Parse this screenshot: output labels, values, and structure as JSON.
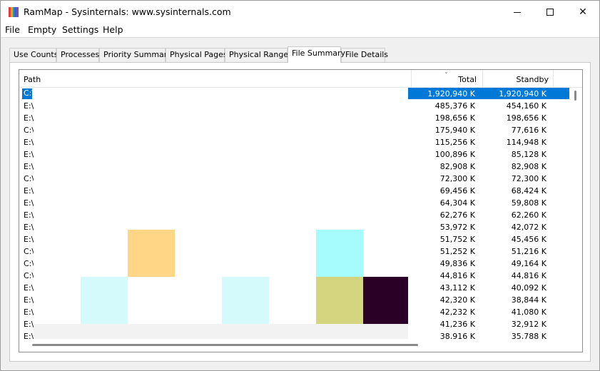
{
  "window": {
    "title": "RamMap - Sysinternals: www.sysinternals.com",
    "icon_colors": [
      "#e63946",
      "#f4a300",
      "#2a9d8f",
      "#3a5fcd",
      "#8e44ad"
    ]
  },
  "menu": {
    "items": [
      "File",
      "Empty",
      "Settings",
      "Help"
    ]
  },
  "tabs": [
    {
      "label": "Use Counts"
    },
    {
      "label": "Processes"
    },
    {
      "label": "Priority Summary"
    },
    {
      "label": "Physical Pages"
    },
    {
      "label": "Physical Ranges"
    },
    {
      "label": "File Summary",
      "active": true
    },
    {
      "label": "File Details"
    }
  ],
  "table": {
    "columns": {
      "path": "Path",
      "total": "Total",
      "standby": "Standby"
    },
    "sort_indicator": "⌄",
    "rows": [
      {
        "path": "C:\\",
        "total": "1,920,940 K",
        "standby": "1,920,940 K",
        "selected": true
      },
      {
        "path": "E:\\",
        "total": "485,376 K",
        "standby": "454,160 K"
      },
      {
        "path": "E:\\",
        "total": "198,656 K",
        "standby": "198,656 K"
      },
      {
        "path": "C:\\",
        "total": "175,940 K",
        "standby": "77,616 K"
      },
      {
        "path": "E:\\",
        "total": "115,256 K",
        "standby": "114,948 K"
      },
      {
        "path": "E:\\",
        "total": "100,896 K",
        "standby": "85,128 K"
      },
      {
        "path": "E:\\",
        "total": "82,908 K",
        "standby": "82,908 K"
      },
      {
        "path": "C:\\",
        "total": "72,300 K",
        "standby": "72,300 K"
      },
      {
        "path": "E:\\",
        "total": "69,456 K",
        "standby": "68,424 K"
      },
      {
        "path": "E:\\",
        "total": "64,304 K",
        "standby": "59,808 K"
      },
      {
        "path": "E:\\",
        "total": "62,276 K",
        "standby": "62,260 K"
      },
      {
        "path": "E:\\",
        "total": "53,972 K",
        "standby": "42,072 K"
      },
      {
        "path": "E:\\",
        "total": "51,752 K",
        "standby": "45,456 K"
      },
      {
        "path": "C:\\",
        "total": "51,252 K",
        "standby": "51,216 K"
      },
      {
        "path": "C:\\",
        "total": "49,836 K",
        "standby": "49,164 K"
      },
      {
        "path": "C:\\",
        "total": "44,816 K",
        "standby": "44,816 K"
      },
      {
        "path": "E:\\",
        "total": "43,112 K",
        "standby": "40,092 K"
      },
      {
        "path": "E:\\",
        "total": "42,320 K",
        "standby": "38,844 K"
      },
      {
        "path": "E:\\",
        "total": "42,232 K",
        "standby": "41,080 K"
      },
      {
        "path": "E:\\",
        "total": "41,236 K",
        "standby": "32,912 K"
      },
      {
        "path": "E:\\",
        "total": "38,916 K",
        "standby": "35,788 K"
      }
    ]
  },
  "redaction_colors": [
    "#ffd685",
    "#a6fbfd",
    "#d5fafc",
    "#d5d47f",
    "#2b0026",
    "#f2f2f2"
  ]
}
